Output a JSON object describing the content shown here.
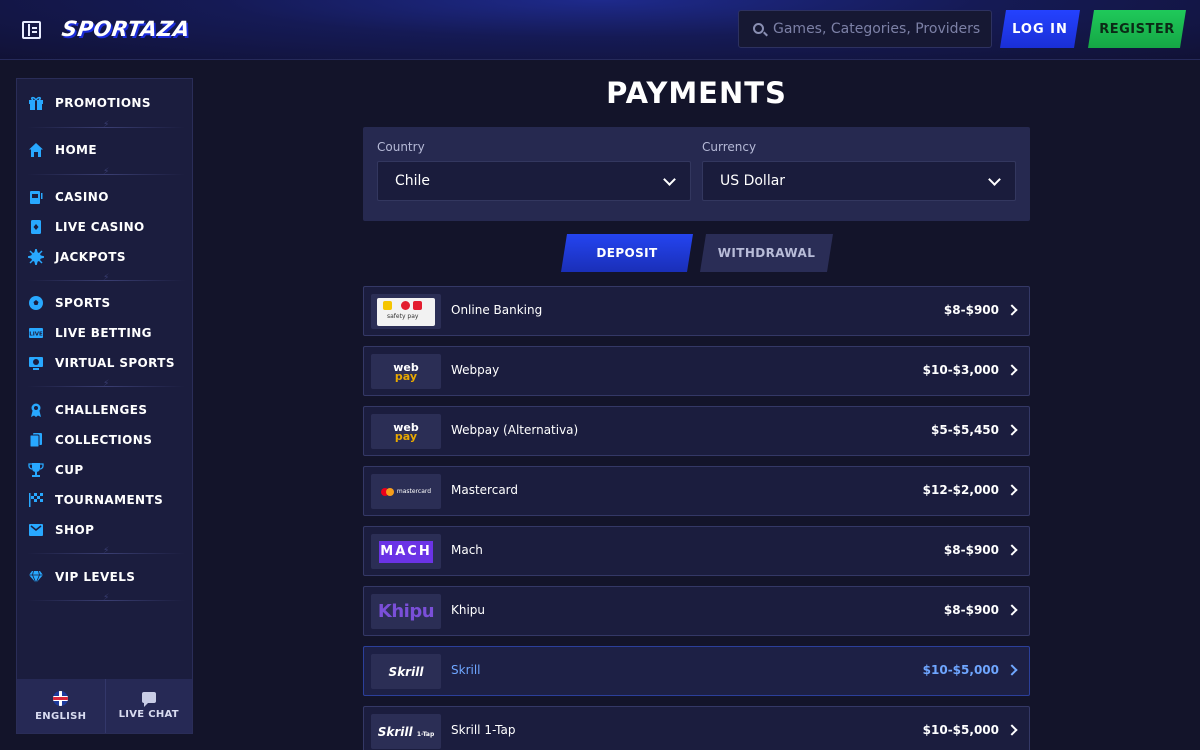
{
  "header": {
    "logo_text": "SPORTAZA",
    "search_placeholder": "Games, Categories, Providers",
    "login_label": "LOG IN",
    "register_label": "REGISTER"
  },
  "sidebar": {
    "items": [
      {
        "label": "PROMOTIONS",
        "icon": "gift-icon"
      },
      {
        "label": "HOME",
        "icon": "home-icon"
      },
      {
        "label": "CASINO",
        "icon": "slot-machine-icon"
      },
      {
        "label": "LIVE CASINO",
        "icon": "playing-card-icon"
      },
      {
        "label": "JACKPOTS",
        "icon": "jackpot-icon"
      },
      {
        "label": "SPORTS",
        "icon": "soccer-ball-icon"
      },
      {
        "label": "LIVE BETTING",
        "icon": "live-icon"
      },
      {
        "label": "VIRTUAL SPORTS",
        "icon": "virtual-sports-icon"
      },
      {
        "label": "CHALLENGES",
        "icon": "medal-icon"
      },
      {
        "label": "COLLECTIONS",
        "icon": "cards-icon"
      },
      {
        "label": "CUP",
        "icon": "trophy-icon"
      },
      {
        "label": "TOURNAMENTS",
        "icon": "checkered-flag-icon"
      },
      {
        "label": "SHOP",
        "icon": "shop-icon"
      },
      {
        "label": "VIP LEVELS",
        "icon": "diamond-icon"
      }
    ],
    "language_label": "ENGLISH",
    "chat_label": "LIVE CHAT"
  },
  "main": {
    "title": "PAYMENTS",
    "country_label": "Country",
    "country_value": "Chile",
    "currency_label": "Currency",
    "currency_value": "US Dollar",
    "tabs": {
      "deposit": "DEPOSIT",
      "withdrawal": "WITHDRAWAL"
    },
    "methods": [
      {
        "name": "Online Banking",
        "range": "$8-$900",
        "logo": "safetypay-logo",
        "logo_text": "safety pay"
      },
      {
        "name": "Webpay",
        "range": "$10-$3,000",
        "logo": "webpay-logo",
        "logo_text_1": "web",
        "logo_text_2": "pay"
      },
      {
        "name": "Webpay (Alternativa)",
        "range": "$5-$5,450",
        "logo": "webpay-logo",
        "logo_text_1": "web",
        "logo_text_2": "pay"
      },
      {
        "name": "Mastercard",
        "range": "$12-$2,000",
        "logo": "mastercard-logo",
        "logo_text": "mastercard"
      },
      {
        "name": "Mach",
        "range": "$8-$900",
        "logo": "mach-logo",
        "logo_text": "MACH"
      },
      {
        "name": "Khipu",
        "range": "$8-$900",
        "logo": "khipu-logo",
        "logo_text": "Khipu"
      },
      {
        "name": "Skrill",
        "range": "$10-$5,000",
        "logo": "skrill-logo",
        "logo_text": "Skrill"
      },
      {
        "name": "Skrill 1-Tap",
        "range": "$10-$5,000",
        "logo": "skrill-1tap-logo",
        "logo_text": "Skrill",
        "logo_subtext": "1-Tap"
      }
    ]
  },
  "colors": {
    "background": "#13142a",
    "accent_blue": "#2444f0",
    "register_green": "#1fc95a",
    "icon_blue": "#28a8ff",
    "active_text": "#6fa6ff"
  }
}
